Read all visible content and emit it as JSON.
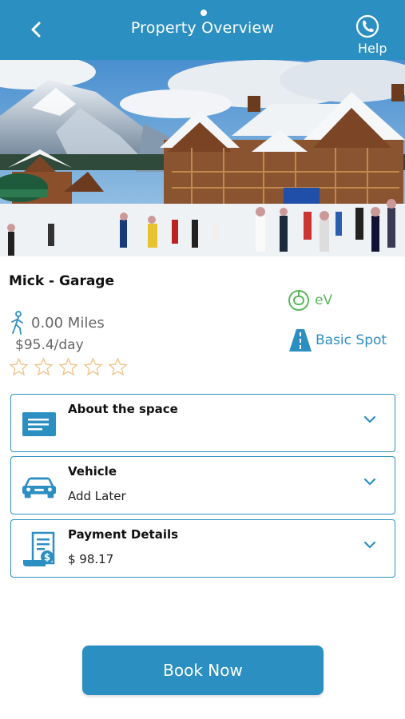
{
  "header": {
    "title": "Property Overview",
    "help_label": "Help",
    "color": "#2c8fc2"
  },
  "spot": {
    "name": "Mick - Garage",
    "distance": "0.00 Miles",
    "price": "$95.4/day",
    "rating": 0,
    "rating_max": 5,
    "ev_label": "eV",
    "spot_type": "Basic Spot"
  },
  "sections": [
    {
      "title": "About the space",
      "value": "",
      "icon": "document-icon"
    },
    {
      "title": "Vehicle",
      "value": "Add Later",
      "icon": "car-icon"
    },
    {
      "title": "Payment Details",
      "value": "$ 98.17",
      "icon": "invoice-icon"
    }
  ],
  "book_button": {
    "label": "Book Now"
  },
  "colors": {
    "primary": "#2c8fc2",
    "ev_green": "#5cb85c",
    "star_outline": "#f0c48a"
  }
}
